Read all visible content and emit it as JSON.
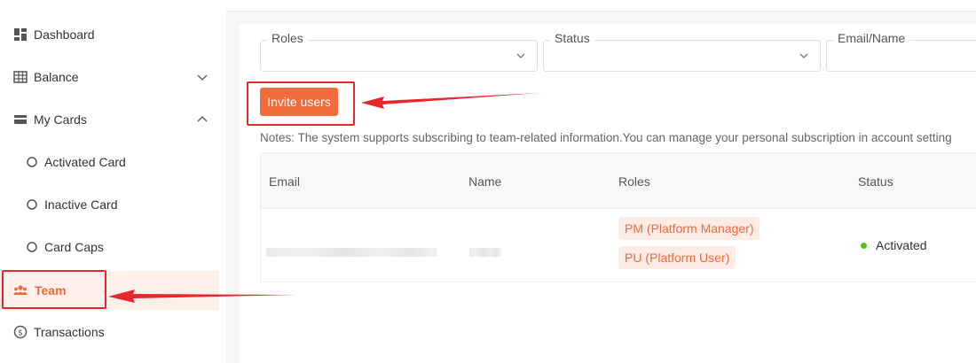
{
  "sidebar": {
    "items": [
      {
        "label": "Dashboard",
        "icon": "dashboard-icon"
      },
      {
        "label": "Balance",
        "icon": "table-icon",
        "expanded": false
      },
      {
        "label": "My Cards",
        "icon": "card-icon",
        "expanded": true
      },
      {
        "label": "Activated Card",
        "icon": "circle-icon"
      },
      {
        "label": "Inactive Card",
        "icon": "circle-icon"
      },
      {
        "label": "Card Caps",
        "icon": "circle-icon"
      },
      {
        "label": "Team",
        "icon": "team-icon",
        "active": true
      },
      {
        "label": "Transactions",
        "icon": "transactions-icon"
      }
    ]
  },
  "filters": {
    "roles": {
      "label": "Roles",
      "value": ""
    },
    "status": {
      "label": "Status",
      "value": ""
    },
    "email": {
      "label": "Email/Name",
      "value": ""
    }
  },
  "actions": {
    "invite_label": "Invite users"
  },
  "notes": "Notes: The system supports subscribing to team-related information.You can manage your personal subscription in account setting",
  "table": {
    "headers": [
      "Email",
      "Name",
      "Roles",
      "Status"
    ],
    "rows": [
      {
        "roles": [
          "PM (Platform Manager)",
          "PU (Platform User)"
        ],
        "status": "Activated"
      }
    ]
  },
  "colors": {
    "accent": "#f26b3a",
    "active_bg": "#fdf0ea",
    "highlight": "#e8262b",
    "status_active": "#52c41a"
  }
}
